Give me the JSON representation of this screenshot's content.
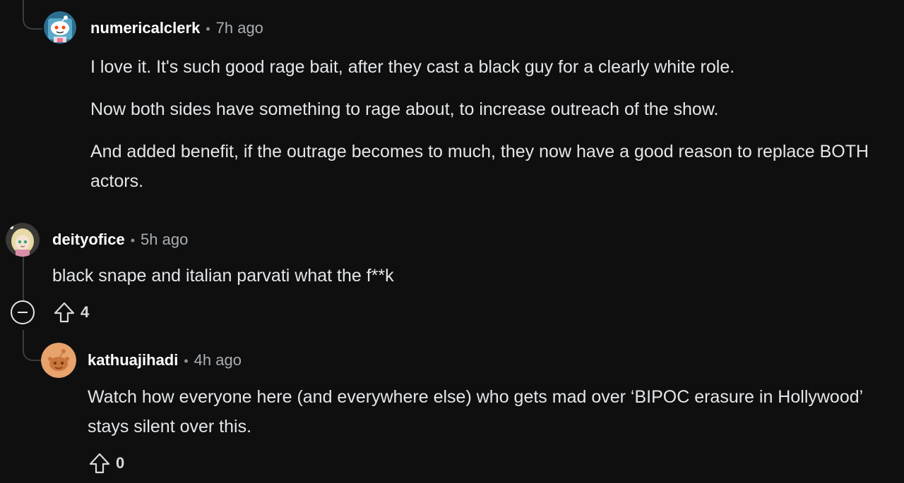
{
  "comments": [
    {
      "username": "numericalclerk",
      "time": "7h ago",
      "paragraphs": [
        "I love it. It's such good rage bait, after they cast a black guy for a clearly white role.",
        "Now both sides have something to rage about, to increase outreach of the show.",
        "And added benefit, if the outrage becomes to much, they now have a good reason to replace BOTH actors."
      ],
      "avatar_icon": "reddit-robot-avatar-icon"
    },
    {
      "username": "deityofice",
      "time": "5h ago",
      "paragraphs": [
        "black snape and italian parvati what the f**k"
      ],
      "votes": "4",
      "avatar_icon": "anime-character-avatar-icon"
    },
    {
      "username": "kathuajihadi",
      "time": "4h ago",
      "paragraphs": [
        "Watch how everyone here (and everywhere else) who gets mad over ‘BIPOC erasure in Hollywood’ stays silent over this."
      ],
      "votes": "0",
      "avatar_icon": "reddit-snoo-orange-avatar-icon"
    }
  ],
  "separator": "•",
  "colors": {
    "background": "#0f0f10",
    "thread_line": "#3a3d40",
    "username": "#ffffff",
    "text": "#e3e6e8",
    "meta": "#a8aeb2"
  }
}
